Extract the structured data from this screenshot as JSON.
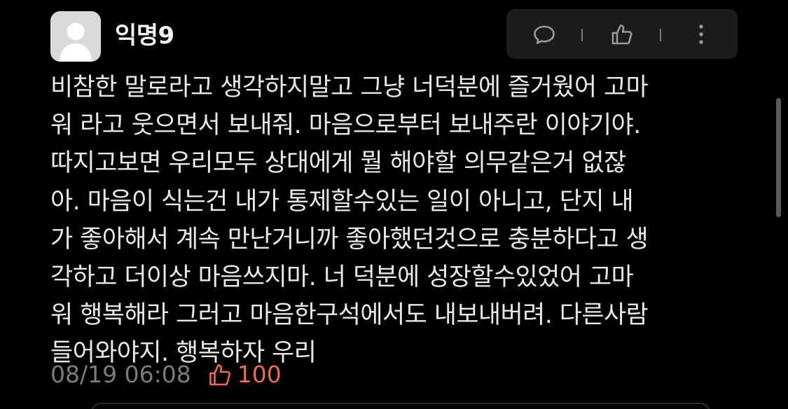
{
  "comment": {
    "author": "익명9",
    "body": "비참한 말로라고 생각하지말고 그냥 너덕분에 즐거웠어 고마\n워 라고 웃으면서 보내줘. 마음으로부터 보내주란 이야기야.\n따지고보면 우리모두 상대에게 뭘 해야할 의무같은거 없잖\n아. 마음이 식는건 내가 통제할수있는 일이 아니고, 단지 내\n가 좋아해서 계속 만난거니까 좋아했던것으로 충분하다고 생\n각하고 더이상 마음쓰지마. 너 덕분에 성장할수있었어 고마\n워 행복해라 그러고 마음한구석에서도 내보내버려. 다른사람\n들어와야지. 행복하자 우리",
    "timestamp": "08/19 06:08",
    "like_count": "100"
  },
  "actions": {
    "icons": [
      "speech-bubble-icon",
      "thumbs-up-icon",
      "vertical-ellipsis-icon"
    ]
  },
  "colors": {
    "background": "#000000",
    "action_bar": "#1c1c1e",
    "text": "#e8e8e8",
    "muted": "#7c7c7c",
    "like_accent": "#f06a52"
  }
}
